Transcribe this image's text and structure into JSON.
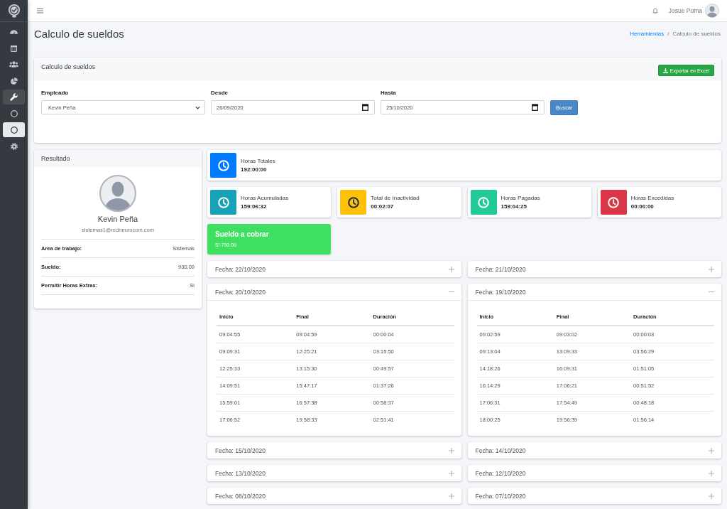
{
  "sidebar": {
    "items": [
      {
        "selected": false,
        "expanded": false
      },
      {
        "selected": false,
        "expanded": false
      },
      {
        "selected": false,
        "expanded": false
      },
      {
        "selected": false,
        "expanded": false
      },
      {
        "selected": false,
        "expanded": true,
        "children": [
          {
            "selected": false
          },
          {
            "selected": true
          }
        ]
      },
      {
        "selected": false,
        "expanded": false
      }
    ]
  },
  "topbar": {
    "user_name": "Josue Puma"
  },
  "page": {
    "title": "Calculo de sueldos",
    "breadcrumb": {
      "separator": "/",
      "items": [
        {
          "label": "Herramientas",
          "kind": "link"
        },
        {
          "label": "Calculo de sueldos",
          "kind": "current"
        }
      ]
    }
  },
  "filter_card": {
    "title": "Calculo de sueldos",
    "export_button": "Exportar en Excel",
    "fields": [
      {
        "label": "Empleado",
        "kind": "select",
        "value": "Kevin Peña"
      },
      {
        "label": "Desde",
        "kind": "date",
        "value": "26/09/2020"
      },
      {
        "label": "Hasta",
        "kind": "date",
        "value": "25/10/2020"
      }
    ],
    "search_button": "Buscar"
  },
  "result_card": {
    "title": "Resultado",
    "name": "Kevin Peña",
    "email": "sistemas1@redneurocom.com",
    "details": [
      {
        "label": "Area de trabajo:",
        "value": "Sistemas"
      },
      {
        "label": "Sueldo:",
        "value": "930.00"
      },
      {
        "label": "Permitir Horas Extras:",
        "value": "Si"
      }
    ]
  },
  "stat_rows": [
    [
      {
        "label": "Horas Totales",
        "value": "192:00:00",
        "color": "#007bff"
      }
    ],
    [
      {
        "label": "Horas Acumuladas",
        "value": "159:06:32",
        "color": "#17a2b8"
      },
      {
        "label": "Total de Inactividad",
        "value": "00:02:07",
        "color": "#ffc107"
      },
      {
        "label": "Horas Pagadas",
        "value": "159:04:25",
        "color": "#20c997"
      },
      {
        "label": "Horas Excedidas",
        "value": "00:00:00",
        "color": "#dc3545"
      }
    ]
  ],
  "salary_box": {
    "title": "Sueldo a cobrar",
    "value": "S/ 750.00"
  },
  "days": [
    {
      "title": "Fecha: 22/10/2020",
      "expanded": false
    },
    {
      "title": "Fecha: 21/10/2020",
      "expanded": false
    },
    {
      "title": "Fecha: 20/10/2020",
      "expanded": true,
      "table": {
        "columns": [
          "Inicio",
          "Final",
          "Duración"
        ],
        "rows": [
          [
            "09:04:55",
            "09:04:59",
            "00:00:04"
          ],
          [
            "09:09:31",
            "12:25:21",
            "03:15:50"
          ],
          [
            "12:25:33",
            "13:15:30",
            "00:49:57"
          ],
          [
            "14:09:51",
            "15:47:17",
            "01:37:26"
          ],
          [
            "15:59:01",
            "16:57:38",
            "00:58:37"
          ],
          [
            "17:06:52",
            "19:58:33",
            "02:51:41"
          ]
        ]
      }
    },
    {
      "title": "Fecha: 19/10/2020",
      "expanded": true,
      "table": {
        "columns": [
          "Inicio",
          "Final",
          "Duración"
        ],
        "rows": [
          [
            "09:02:59",
            "09:03:02",
            "00:00:03"
          ],
          [
            "09:13:04",
            "13:09:33",
            "03:56:29"
          ],
          [
            "14:18:26",
            "16:09:31",
            "01:51:05"
          ],
          [
            "16:14:29",
            "17:06:21",
            "00:51:52"
          ],
          [
            "17:06:31",
            "17:54:49",
            "00:48:18"
          ],
          [
            "18:00:25",
            "19:56:39",
            "01:56:14"
          ]
        ]
      }
    },
    {
      "title": "Fecha: 15/10/2020",
      "expanded": false
    },
    {
      "title": "Fecha: 14/10/2020",
      "expanded": false
    },
    {
      "title": "Fecha: 13/10/2020",
      "expanded": false
    },
    {
      "title": "Fecha: 12/10/2020",
      "expanded": false
    },
    {
      "title": "Fecha: 08/10/2020",
      "expanded": false
    },
    {
      "title": "Fecha: 07/10/2020",
      "expanded": false
    }
  ]
}
